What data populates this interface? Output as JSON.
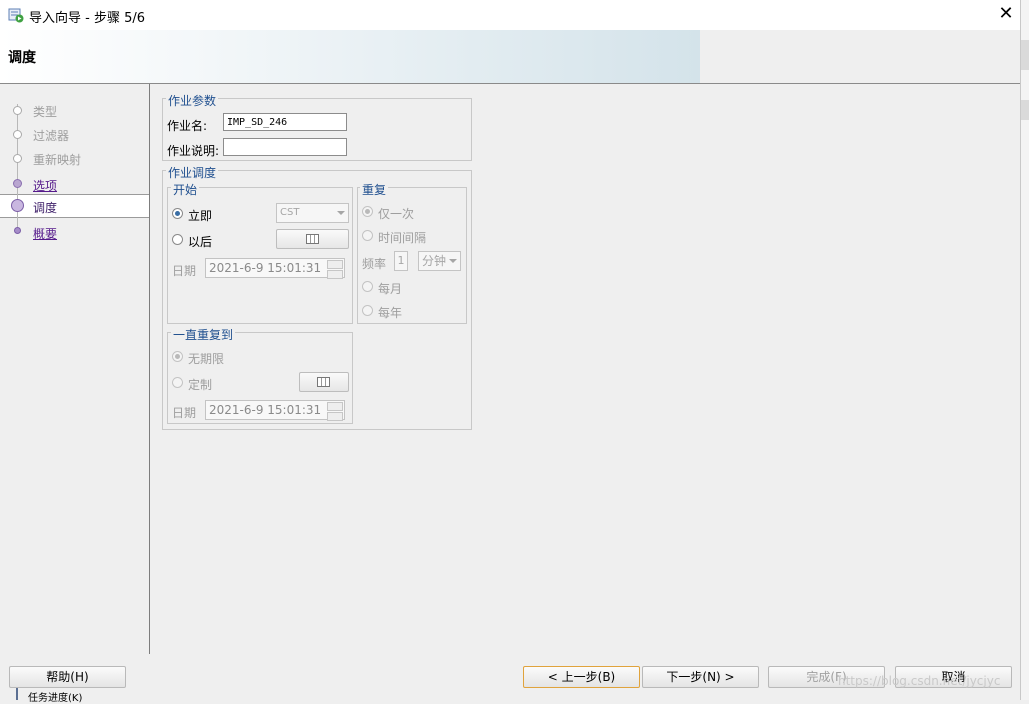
{
  "window": {
    "title": "导入向导 - 步骤 5/6"
  },
  "header": {
    "title": "调度"
  },
  "nav": {
    "items": [
      {
        "label": "类型",
        "state": "done"
      },
      {
        "label": "过滤器",
        "state": "done"
      },
      {
        "label": "重新映射",
        "state": "done"
      },
      {
        "label": "选项",
        "state": "link"
      },
      {
        "label": "调度",
        "state": "current"
      },
      {
        "label": "概要",
        "state": "link"
      }
    ]
  },
  "job_params": {
    "legend": "作业参数",
    "name_label": "作业名:",
    "name_value": "IMP_SD_246",
    "desc_label": "作业说明:",
    "desc_value": ""
  },
  "job_schedule": {
    "legend": "作业调度",
    "start": {
      "legend": "开始",
      "immediate_label": "立即",
      "later_label": "以后",
      "timezone": "CST",
      "date_label": "日期",
      "date_value": "2021-6-9 15:01:31",
      "selected": "immediate"
    },
    "repeat": {
      "legend": "重复",
      "once_label": "仅一次",
      "interval_label": "时间间隔",
      "freq_label": "频率",
      "freq_value": "1",
      "freq_unit": "分钟",
      "monthly_label": "每月",
      "yearly_label": "每年",
      "selected": "once"
    },
    "until": {
      "legend": "一直重复到",
      "forever_label": "无期限",
      "custom_label": "定制",
      "date_label": "日期",
      "date_value": "2021-6-9 15:01:31",
      "selected": "forever"
    }
  },
  "buttons": {
    "help": "帮助(H)",
    "back": "< 上一步(B)",
    "next": "下一步(N) >",
    "finish": "完成(F)",
    "cancel": "取消"
  },
  "status": {
    "text": "任务进度(K)"
  },
  "watermark": "https://blog.csdn.net/jycjyc"
}
